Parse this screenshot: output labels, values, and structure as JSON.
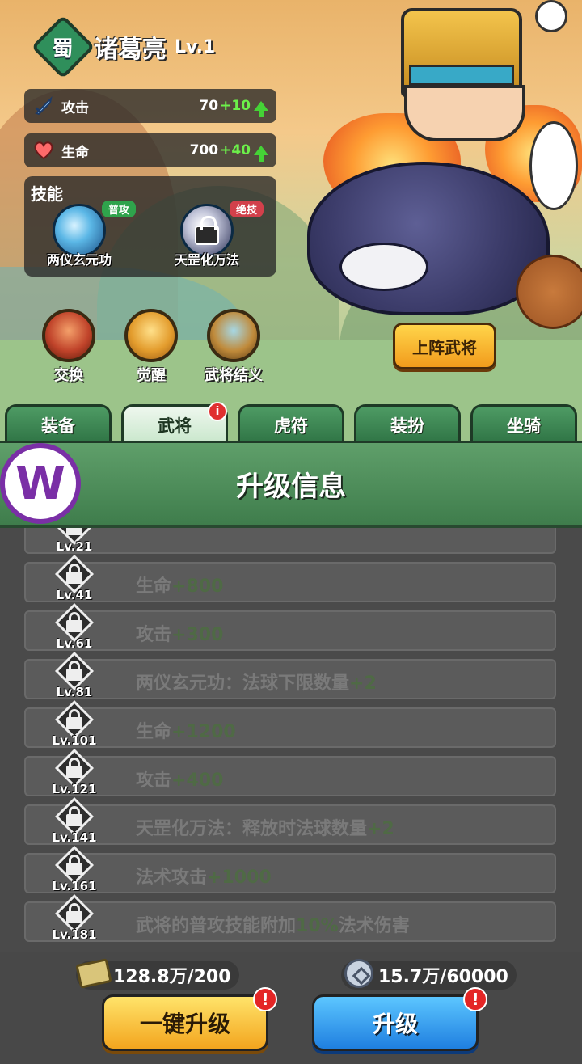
{
  "hero": {
    "kingdom": "蜀",
    "name": "诸葛亮",
    "level": "Lv.1"
  },
  "stats": [
    {
      "icon": "sword-icon",
      "label": "攻击",
      "value": "70",
      "increase": "+10"
    },
    {
      "icon": "heart-icon",
      "label": "生命",
      "value": "700",
      "increase": "+40"
    }
  ],
  "skills": {
    "header": "技能",
    "items": [
      {
        "name": "两仪玄元功",
        "tag": "普攻",
        "locked": false
      },
      {
        "name": "天罡化万法",
        "tag": "绝技",
        "locked": true
      }
    ]
  },
  "actions": [
    {
      "label": "交换",
      "icon": "warrior-portrait-icon"
    },
    {
      "label": "觉醒",
      "icon": "awaken-helmet-icon"
    },
    {
      "label": "武将结义",
      "icon": "oath-altar-icon"
    }
  ],
  "deploy_button": "上阵武将",
  "tabs": [
    {
      "label": "装备",
      "active": false,
      "badge": ""
    },
    {
      "label": "武将",
      "active": true,
      "badge": "i"
    },
    {
      "label": "虎符",
      "active": false,
      "badge": ""
    },
    {
      "label": "装扮",
      "active": false,
      "badge": ""
    },
    {
      "label": "坐骑",
      "active": false,
      "badge": ""
    }
  ],
  "upgrade_title": "升级信息",
  "watermark": "W",
  "upgrade_rows": [
    {
      "level": "Lv.21",
      "text": "",
      "bonus": ""
    },
    {
      "level": "Lv.41",
      "text": "生命",
      "bonus": "+800"
    },
    {
      "level": "Lv.61",
      "text": "攻击",
      "bonus": "+300"
    },
    {
      "level": "Lv.81",
      "text": "两仪玄元功：法球下限数量",
      "bonus": "+2"
    },
    {
      "level": "Lv.101",
      "text": "生命",
      "bonus": "+1200"
    },
    {
      "level": "Lv.121",
      "text": "攻击",
      "bonus": "+400"
    },
    {
      "level": "Lv.141",
      "text": "天罡化万法：释放时法球数量",
      "bonus": "+2"
    },
    {
      "level": "Lv.161",
      "text": "法术攻击",
      "bonus": "+1000"
    },
    {
      "level": "Lv.181",
      "text": "武将的普攻技能附加",
      "bonus": "10%",
      "suffix": "法术伤害"
    }
  ],
  "resources": [
    {
      "icon": "scroll-icon",
      "amount": "128.8万/200"
    },
    {
      "icon": "silver-coin-icon",
      "amount": "15.7万/60000"
    }
  ],
  "buttons": {
    "one_click": "一键升级",
    "upgrade": "升级",
    "alert": "!"
  }
}
